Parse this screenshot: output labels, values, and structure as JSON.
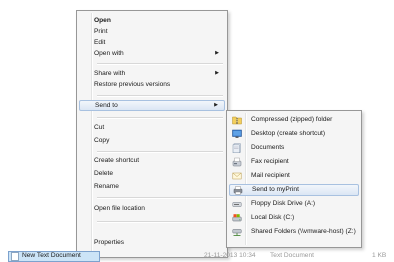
{
  "context_menu": {
    "items": [
      {
        "label": "Open",
        "bold": true
      },
      {
        "label": "Print"
      },
      {
        "label": "Edit"
      },
      {
        "label": "Open with",
        "submenu": true
      },
      {
        "label": "Share with",
        "submenu": true
      },
      {
        "label": "Restore previous versions"
      },
      {
        "label": "Send to",
        "submenu": true,
        "highlighted": true
      },
      {
        "label": "Cut"
      },
      {
        "label": "Copy"
      },
      {
        "label": "Create shortcut"
      },
      {
        "label": "Delete"
      },
      {
        "label": "Rename"
      },
      {
        "label": "Open file location"
      },
      {
        "label": "Properties"
      }
    ]
  },
  "send_to_menu": {
    "items": [
      {
        "label": "Compressed (zipped) folder",
        "icon": "zip-folder-icon"
      },
      {
        "label": "Desktop (create shortcut)",
        "icon": "desktop-icon"
      },
      {
        "label": "Documents",
        "icon": "documents-icon"
      },
      {
        "label": "Fax recipient",
        "icon": "fax-icon"
      },
      {
        "label": "Mail recipient",
        "icon": "mail-icon"
      },
      {
        "label": "Send to myPrint",
        "icon": "myprint-icon",
        "highlighted": true
      },
      {
        "label": "Floppy Disk Drive (A:)",
        "icon": "floppy-drive-icon"
      },
      {
        "label": "Local Disk (C:)",
        "icon": "local-disk-icon"
      },
      {
        "label": "Shared Folders (\\\\vmware-host) (Z:)",
        "icon": "network-drive-icon"
      }
    ]
  },
  "file_row": {
    "name": "New Text Document",
    "date": "21-11-2013 10:34",
    "type": "Text Document",
    "size": "1 KB"
  }
}
